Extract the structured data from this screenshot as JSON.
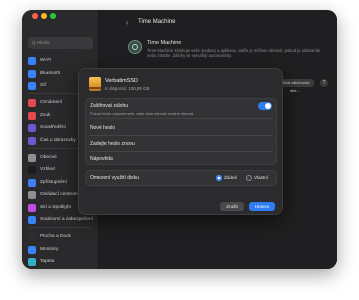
{
  "window": {
    "title": "Time Machine"
  },
  "search": {
    "placeholder": "Q  Hledat"
  },
  "sidebar": {
    "items": [
      {
        "label": "Wi-Fi",
        "icon": "wifi-icon",
        "color": "#3a82f6"
      },
      {
        "label": "Bluetooth",
        "icon": "bluetooth-icon",
        "color": "#3a82f6"
      },
      {
        "label": "Síť",
        "icon": "network-icon",
        "color": "#3a82f6"
      },
      {
        "label": "Oznámení",
        "icon": "notifications-icon",
        "color": "#e5484d"
      },
      {
        "label": "Zvuk",
        "icon": "sound-icon",
        "color": "#e5484d"
      },
      {
        "label": "Soustředění",
        "icon": "focus-icon",
        "color": "#6e56cf"
      },
      {
        "label": "Čas u obrazovky",
        "icon": "screentime-icon",
        "color": "#6e56cf"
      },
      {
        "label": "Obecné",
        "icon": "gear-icon",
        "color": "#8e8e93"
      },
      {
        "label": "Vzhled",
        "icon": "appearance-icon",
        "color": "#1c1c1e"
      },
      {
        "label": "Zpřístupnění",
        "icon": "accessibility-icon",
        "color": "#3a82f6"
      },
      {
        "label": "Ovládací centrum",
        "icon": "control-center-icon",
        "color": "#8e8e93"
      },
      {
        "label": "Siri a Spotlight",
        "icon": "siri-icon",
        "color": "#c44fe0"
      },
      {
        "label": "Soukromí a zabezpečení",
        "icon": "privacy-icon",
        "color": "#3a82f6"
      },
      {
        "label": "Plocha a Dock",
        "icon": "desktop-dock-icon",
        "color": "#2c2c2e"
      },
      {
        "label": "Monitory",
        "icon": "displays-icon",
        "color": "#3a82f6"
      },
      {
        "label": "Tapeta",
        "icon": "wallpaper-icon",
        "color": "#30b0c7"
      }
    ]
  },
  "main": {
    "back_glyph": "‹",
    "time_machine": {
      "name": "Time Machine",
      "description": "Time Machine zálohuje vaše soubory a aplikace, takže je můžete obnovit, pokud je odstraníte nebo ztratíte. Zálohy se vytvářejí automaticky."
    },
    "behind_button_label": "Přidat zálohovací disk…",
    "help_label": "?"
  },
  "sheet": {
    "drive_name": "VerbatimSSD",
    "drive_size": "K dispozici: 100,89 GB",
    "encrypt": {
      "label": "Zašifrovat zálohu",
      "subtitle": "Pokud heslo zapomenete, vaše data nebude možné obnovit.",
      "enabled": true
    },
    "fields": {
      "new_password": "Nové heslo",
      "verify_password": "Zadejte heslo znovu",
      "hint": "Nápověda"
    },
    "disk_limit": {
      "label": "Omezení využití disku",
      "options": [
        "Žádné",
        "Vlastní"
      ],
      "selected": "Žádné"
    },
    "buttons": {
      "cancel": "Zrušit",
      "done": "Hotovo"
    }
  },
  "colors": {
    "accent": "#2f7cf6",
    "window_bg": "#1f1f21",
    "sheet_bg": "#2b2b2d"
  }
}
